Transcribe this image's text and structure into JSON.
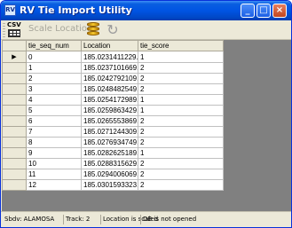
{
  "window": {
    "title": "RV Tie Import Utility"
  },
  "toolbar": {
    "csv_label": "CSV",
    "scale_location_label": "Scale Location"
  },
  "grid": {
    "columns": [
      "tie_seq_num",
      "Location",
      "tie_score"
    ],
    "rows": [
      [
        "0",
        "185.0231411229...",
        "1"
      ],
      [
        "1",
        "185.0237101669...",
        "2"
      ],
      [
        "2",
        "185.0242792109...",
        "2"
      ],
      [
        "3",
        "185.0248482549...",
        "2"
      ],
      [
        "4",
        "185.0254172989...",
        "1"
      ],
      [
        "5",
        "185.0259863429...",
        "1"
      ],
      [
        "6",
        "185.0265553869...",
        "2"
      ],
      [
        "7",
        "185.0271244309...",
        "2"
      ],
      [
        "8",
        "185.0276934749...",
        "2"
      ],
      [
        "9",
        "185.0282625189...",
        "1"
      ],
      [
        "10",
        "185.0288315629...",
        "2"
      ],
      [
        "11",
        "185.0294006069...",
        "2"
      ],
      [
        "12",
        "185.0301593323...",
        "2"
      ]
    ]
  },
  "status": {
    "subdivision": "Sbdv: ALAMOSA",
    "track": "Track: 2",
    "location_state": "Location is scaled",
    "db_state": "DB is not opened"
  }
}
